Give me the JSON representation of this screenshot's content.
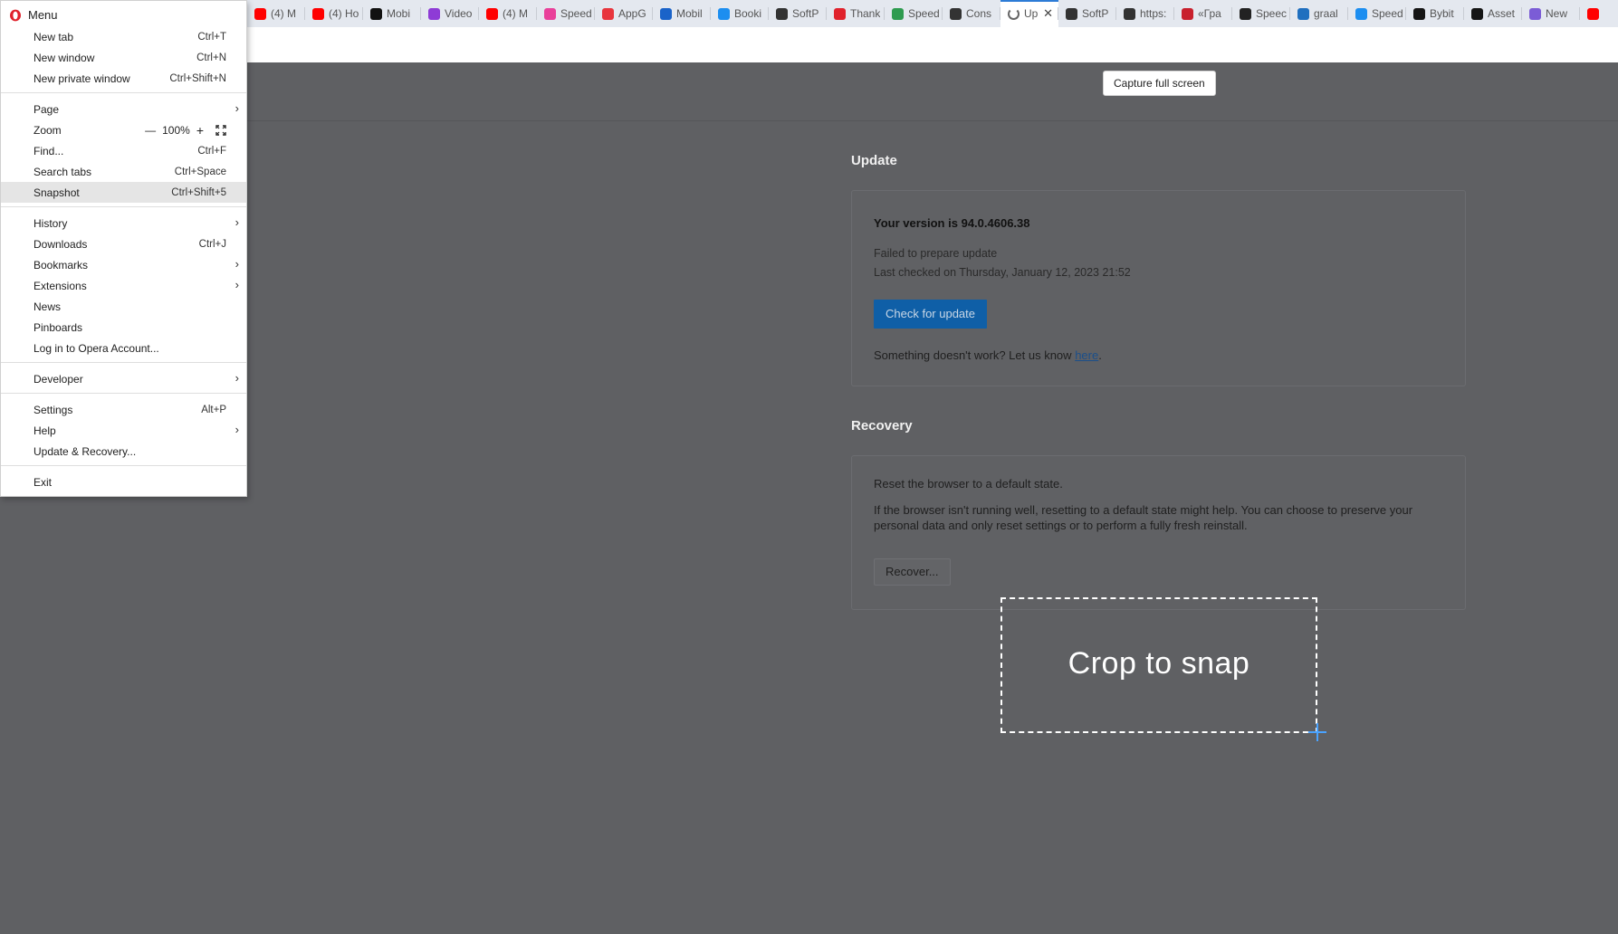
{
  "tabs": [
    {
      "label": "(4) M",
      "icon": "youtube-icon",
      "color": "#ff0000"
    },
    {
      "label": "(4) Ho",
      "icon": "youtube-icon",
      "color": "#ff0000"
    },
    {
      "label": "Mobi",
      "icon": "tiktok-icon",
      "color": "#111111"
    },
    {
      "label": "Video",
      "icon": "play-icon",
      "color": "#8e3bd6"
    },
    {
      "label": "(4) M",
      "icon": "youtube-icon",
      "color": "#ff0000"
    },
    {
      "label": "Speed",
      "icon": "speedtest-icon",
      "color": "#e9409a"
    },
    {
      "label": "AppG",
      "icon": "appgallery-icon",
      "color": "#e8353d"
    },
    {
      "label": "Mobil",
      "icon": "malwarebytes-icon",
      "color": "#1a63c9"
    },
    {
      "label": "Booki",
      "icon": "appstore-icon",
      "color": "#1c8ef0"
    },
    {
      "label": "SoftP",
      "icon": "softpedia-icon",
      "color": "#333333"
    },
    {
      "label": "Thank",
      "icon": "opera-icon",
      "color": "#e0222c"
    },
    {
      "label": "Speed",
      "icon": "google-play-icon",
      "color": "#2e9b4f"
    },
    {
      "label": "Cons",
      "icon": "github-icon",
      "color": "#333333"
    },
    {
      "label": "Up",
      "icon": "loading-icon",
      "color": "#666666",
      "active": true
    },
    {
      "label": "SoftP",
      "icon": "softpedia-icon",
      "color": "#333333"
    },
    {
      "label": "https:",
      "icon": "softpedia-icon",
      "color": "#333333"
    },
    {
      "label": "«Гра",
      "icon": "chart-icon",
      "color": "#c8202d"
    },
    {
      "label": "Speec",
      "icon": "amazon-icon",
      "color": "#222222"
    },
    {
      "label": "graal",
      "icon": "edge-icon",
      "color": "#1f6fbf"
    },
    {
      "label": "Speed",
      "icon": "appstore-icon",
      "color": "#1c8ef0"
    },
    {
      "label": "Bybit",
      "icon": "bybit-icon",
      "color": "#151515"
    },
    {
      "label": "Asset",
      "icon": "asset-icon",
      "color": "#151515"
    },
    {
      "label": "New",
      "icon": "ai-icon",
      "color": "#7b5cd6"
    },
    {
      "label": "",
      "icon": "youtube-icon",
      "color": "#ff0000"
    }
  ],
  "capture_button": "Capture full screen",
  "update": {
    "section_title": "Update",
    "version_label": "Your version is",
    "version": "94.0.4606.38",
    "status": "Failed to prepare update",
    "last_checked": "Last checked on Thursday, January 12, 2023 21:52",
    "check_button": "Check for update",
    "feedback_text": "Something doesn't work? Let us know",
    "feedback_link": "here",
    "feedback_end": "."
  },
  "recovery": {
    "section_title": "Recovery",
    "reset_text": "Reset the browser to a default state.",
    "description_line1": "If the browser isn't running well, resetting to a default state might help. You can choose to preserve your",
    "description_line2": "personal data and only reset settings or to perform a fully fresh reinstall.",
    "recover_button": "Recover..."
  },
  "crop_label": "Crop to snap",
  "menu": {
    "title": "Menu",
    "items": [
      {
        "label": "New tab",
        "shortcut": "Ctrl+T"
      },
      {
        "label": "New window",
        "shortcut": "Ctrl+N"
      },
      {
        "label": "New private window",
        "shortcut": "Ctrl+Shift+N"
      },
      {
        "label": "Page",
        "shortcut": ""
      },
      {
        "label": "Zoom",
        "shortcut": ""
      },
      {
        "label": "Find...",
        "shortcut": "Ctrl+F"
      },
      {
        "label": "Search tabs",
        "shortcut": "Ctrl+Space"
      },
      {
        "label": "Snapshot",
        "shortcut": "Ctrl+Shift+5"
      },
      {
        "label": "History",
        "shortcut": ""
      },
      {
        "label": "Downloads",
        "shortcut": "Ctrl+J"
      },
      {
        "label": "Bookmarks",
        "shortcut": ""
      },
      {
        "label": "Extensions",
        "shortcut": ""
      },
      {
        "label": "News",
        "shortcut": ""
      },
      {
        "label": "Pinboards",
        "shortcut": ""
      },
      {
        "label": "Log in to Opera Account...",
        "shortcut": ""
      },
      {
        "label": "Developer",
        "shortcut": ""
      },
      {
        "label": "Settings",
        "shortcut": "Alt+P"
      },
      {
        "label": "Help",
        "shortcut": ""
      },
      {
        "label": "Update & Recovery...",
        "shortcut": ""
      },
      {
        "label": "Exit",
        "shortcut": ""
      }
    ],
    "zoom": {
      "minus": "—",
      "value": "100%",
      "plus": "+"
    }
  }
}
